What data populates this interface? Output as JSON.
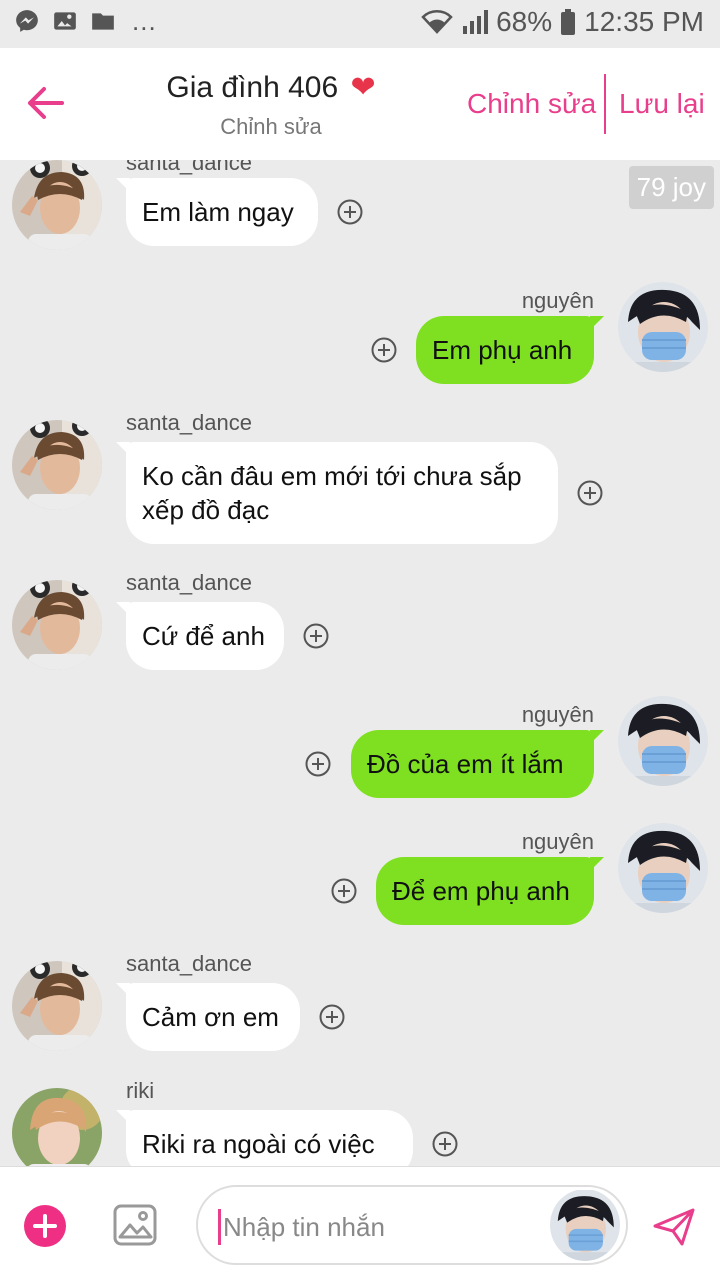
{
  "status_bar": {
    "battery": "68%",
    "time": "12:35 PM",
    "dots": "...",
    "icons": [
      "messenger-icon",
      "gallery-icon",
      "folder-icon",
      "wifi-icon",
      "signal-icon",
      "battery-icon"
    ]
  },
  "header": {
    "title": "Gia đình 406",
    "heart": "❤",
    "subtitle": "Chỉnh sửa",
    "edit_label": "Chỉnh sửa",
    "save_label": "Lưu lại"
  },
  "joy_badge": "79 joy",
  "messages": [
    {
      "side": "left",
      "sender": "santa_dance",
      "text": "Em làm ngay"
    },
    {
      "side": "right",
      "sender": "nguyên",
      "text": "Em phụ anh"
    },
    {
      "side": "left",
      "sender": "santa_dance",
      "text": "Ko cần đâu em mới tới chưa sắp xếp đồ đạc"
    },
    {
      "side": "left",
      "sender": "santa_dance",
      "text": "Cứ để anh"
    },
    {
      "side": "right",
      "sender": "nguyên",
      "text": "Đồ của em ít lắm"
    },
    {
      "side": "right",
      "sender": "nguyên",
      "text": "Để em phụ anh"
    },
    {
      "side": "left",
      "sender": "santa_dance",
      "text": "Cảm ơn em"
    },
    {
      "side": "left",
      "sender": "riki",
      "text": "Riki ra ngoài có việc"
    }
  ],
  "composer": {
    "placeholder": "Nhập tin nhắn"
  },
  "colors": {
    "accent": "#e83e8c",
    "bubble_right": "#7ee020",
    "bubble_left": "#ffffff",
    "background": "#ebebeb"
  }
}
